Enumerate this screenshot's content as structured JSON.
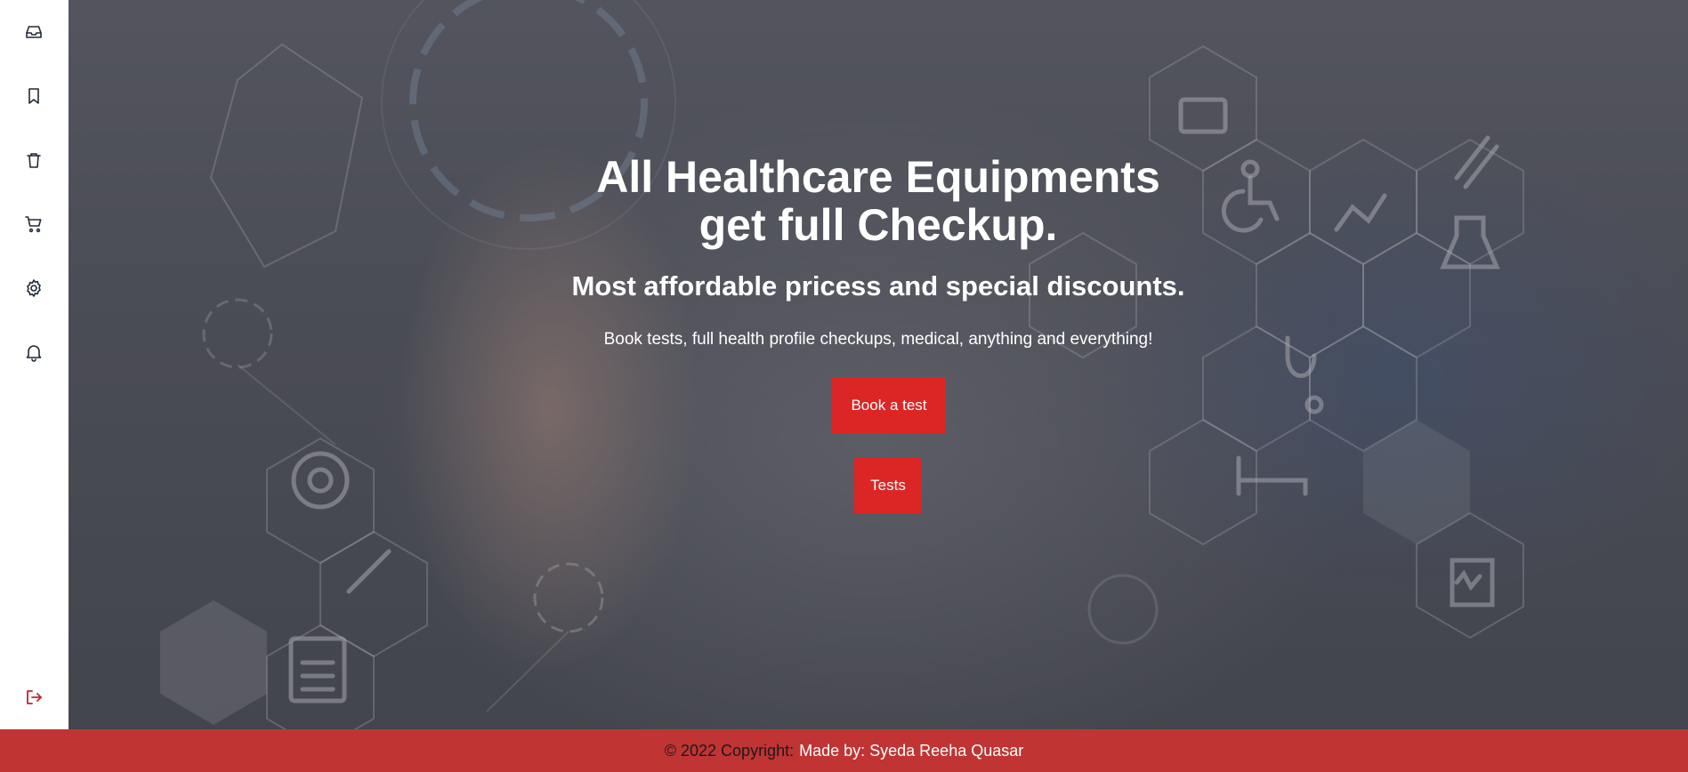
{
  "sidebar": {
    "items": [
      {
        "icon": "inbox-icon"
      },
      {
        "icon": "bookmark-icon"
      },
      {
        "icon": "trash-icon"
      },
      {
        "icon": "cart-icon"
      },
      {
        "icon": "gear-icon"
      },
      {
        "icon": "bell-icon"
      }
    ],
    "logout_icon": "logout-icon",
    "logout_color": "#c0262d"
  },
  "hero": {
    "title_line1": "All Healthcare Equipments",
    "title_line2": "get full Checkup.",
    "subtitle": "Most affordable pricess and special discounts.",
    "lead": "Book tests, full health profile checkups, medical, anything and everything!",
    "primary_button": "Book a test",
    "secondary_button": "Tests",
    "button_color": "#dc2626"
  },
  "footer": {
    "copyright": "© 2022 Copyright:",
    "made_by": "Made by: Syeda Reeha Quasar",
    "background": "#c03434"
  }
}
